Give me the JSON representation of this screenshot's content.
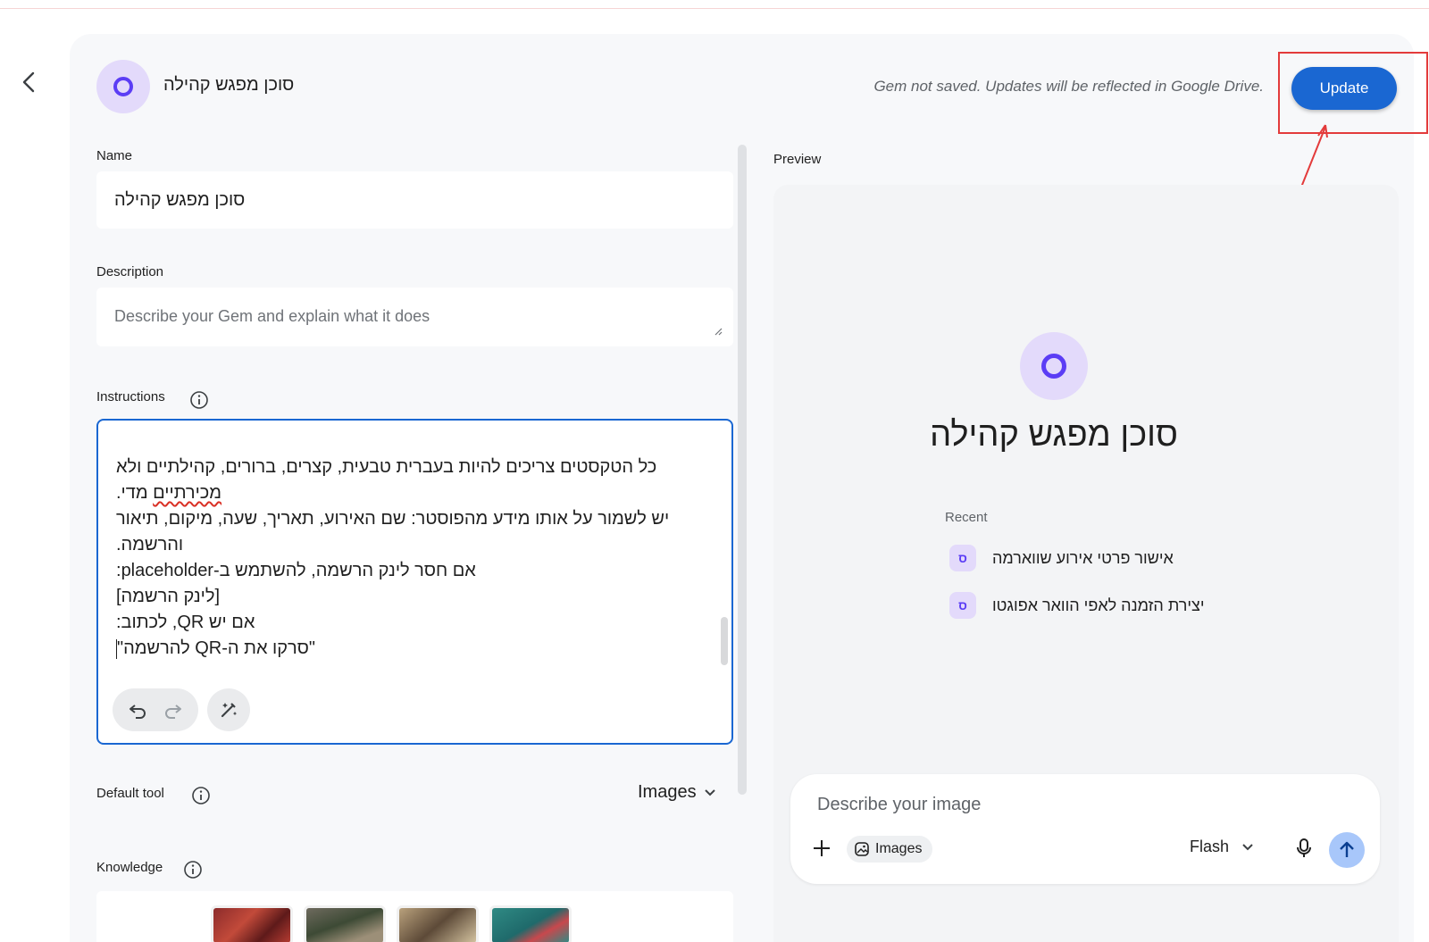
{
  "header": {
    "gem_name": "סוכן מפגש קהילה",
    "save_note": "Gem not saved. Updates will be reflected in Google Drive.",
    "update_label": "Update"
  },
  "form": {
    "name_label": "Name",
    "name_value": "סוכן מפגש קהילה",
    "description_label": "Description",
    "description_placeholder": "Describe your Gem and explain what it does",
    "instructions_label": "Instructions",
    "instructions_lines": [
      "כל הטקסטים צריכים להיות בעברית טבעית, קצרים, ברורים, קהילתיים ולא",
      "מכירתיים מדי.",
      "יש לשמור על אותו מידע מהפוסטר: שם האירוע, תאריך, שעה, מיקום, תיאור",
      "והרשמה.",
      "אם חסר לינק הרשמה, להשתמש ב-placeholder:",
      "[לינק הרשמה]",
      "אם יש QR, לכתוב:",
      "\"סרקו את ה-QR להרשמה\""
    ],
    "instructions_squiggle_word": "מכירתיים",
    "default_tool_label": "Default tool",
    "default_tool_value": "Images",
    "knowledge_label": "Knowledge"
  },
  "preview": {
    "label": "Preview",
    "gem_title": "סוכן מפגש קהילה",
    "recent_label": "Recent",
    "recent_items": [
      {
        "badge": "ס",
        "text": "אישור פרטי אירוע שווארמה"
      },
      {
        "badge": "ס",
        "text": "יצירת הזמנה לאפי הוואר אפוגטו"
      }
    ],
    "chat_placeholder": "Describe your image",
    "chip_label": "Images",
    "model_label": "Flash"
  },
  "icons": {
    "back": "chevron-left-icon",
    "info": "info-icon",
    "undo": "undo-icon",
    "redo": "redo-icon",
    "magic": "magic-wand-icon",
    "plus": "plus-icon",
    "mic": "mic-icon",
    "send": "arrow-up-icon"
  },
  "colors": {
    "accent": "#1a67d2",
    "gem_ring": "#5b3df5",
    "gem_bg": "#e3dafb",
    "annotation": "#e33b3b"
  }
}
